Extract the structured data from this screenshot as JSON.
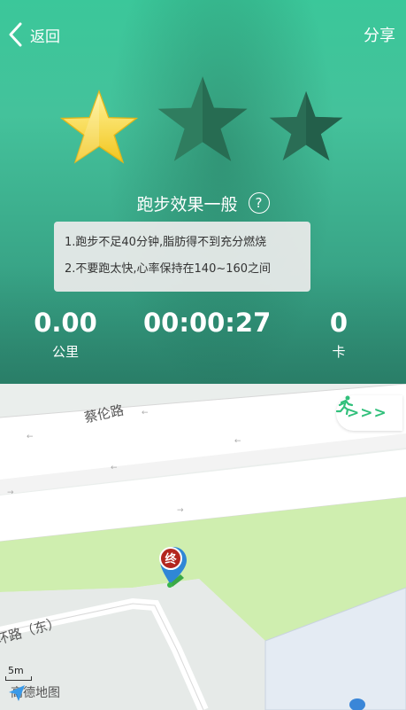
{
  "header": {
    "back_label": "返回",
    "share_label": "分享"
  },
  "rating": {
    "filled_stars": 1,
    "total_stars": 3,
    "verdict": "跑步效果一般",
    "help_glyph": "?"
  },
  "tips": [
    "1.跑步不足40分钟,脂肪得不到充分燃烧",
    "2.不要跑太快,心率保持在140~160之间"
  ],
  "stats": {
    "distance": {
      "value": "0.00",
      "unit": "公里"
    },
    "duration": {
      "value": "00:00:27",
      "unit": ""
    },
    "calories": {
      "value": "0",
      "unit": "卡"
    }
  },
  "map": {
    "road_1": "蔡伦路",
    "road_2": "环路（东）",
    "end_marker_label": "终",
    "run_button_arrows": ">>>",
    "scale_label": "5m",
    "provider_name": "高德地图"
  },
  "colors": {
    "accent_green": "#31c07b",
    "hero_green": "#3bc79a",
    "star_gold": "#ffe34f",
    "end_marker": "#b3261e"
  },
  "icons": {
    "back": "chevron-left-icon",
    "help": "question-circle-icon",
    "run": "running-man-icon",
    "logo": "amap-logo-icon"
  }
}
